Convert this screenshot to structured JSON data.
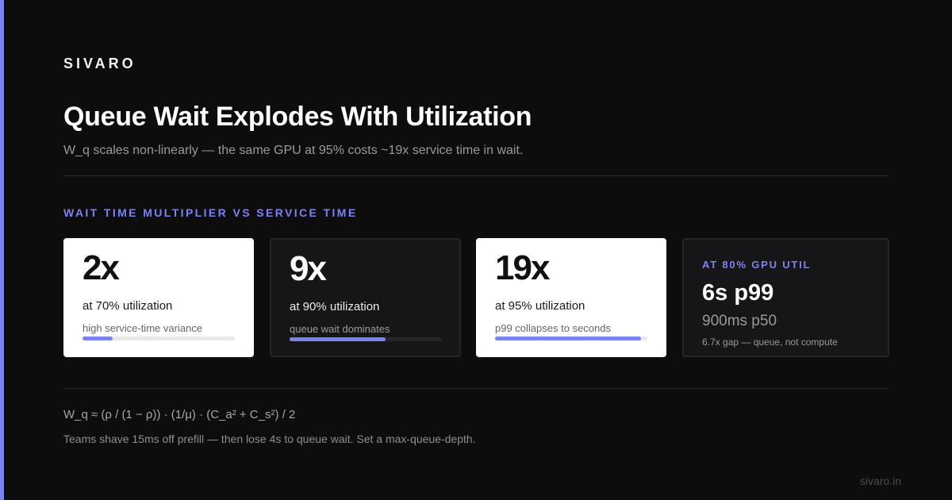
{
  "brand": "SIVARO",
  "title": "Queue Wait Explodes With Utilization",
  "subtitle": "W_q scales non-linearly — the same GPU at 95% costs ~19x service time in wait.",
  "section_label": "WAIT TIME MULTIPLIER VS SERVICE TIME",
  "cards": [
    {
      "value": "2x",
      "util": "at 70% utilization",
      "note": "high service-time variance",
      "progress": 0.2
    },
    {
      "value": "9x",
      "util": "at 90% utilization",
      "note": "queue wait dominates",
      "progress": 0.63
    },
    {
      "value": "19x",
      "util": "at 95% utilization",
      "note": "p99 collapses to seconds",
      "progress": 0.96
    }
  ],
  "stat_card": {
    "eyebrow": "AT 80% GPU UTIL",
    "p99": "6s p99",
    "p50": "900ms p50",
    "gap": "6.7x gap — queue, not compute"
  },
  "formula": "W_q ≈ (ρ / (1 − ρ)) · (1/μ) · (C_a² + C_s²) / 2",
  "footnote": "Teams shave 15ms off prefill — then lose 4s to queue wait. Set a max-queue-depth.",
  "site": "sivaro.in",
  "colors": {
    "accent": "#7c83f0",
    "background": "#0d0d0d",
    "card_light": "#ffffff",
    "card_dark": "#161618"
  }
}
